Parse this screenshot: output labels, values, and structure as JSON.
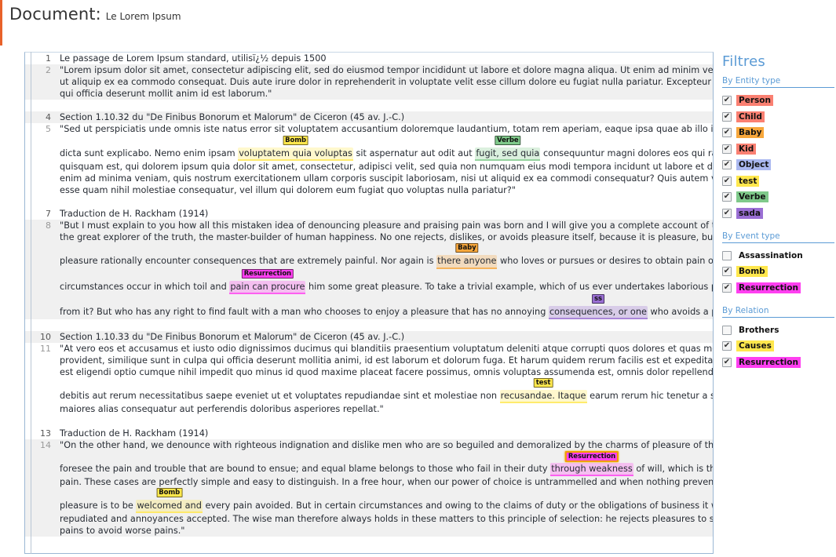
{
  "header": {
    "title": "Document:",
    "subtitle": "Le Lorem Ipsum"
  },
  "colors": {
    "person": "#fa8072",
    "child": "#fa8072",
    "baby": "#f7a73c",
    "kid": "#fa8072",
    "object": "#aab8f0",
    "test": "#ffe74d",
    "verbe": "#7fc98a",
    "sada": "#9a6fd4",
    "bomb": "#ffe74d",
    "resurrection": "#ff3ff0",
    "causes": "#ffe74d",
    "accent_blue": "#5b9bd5",
    "accent_orange": "#e8622a"
  },
  "sidebar": {
    "title": "Filtres",
    "sections": [
      {
        "name": "entity",
        "heading": "By Entity type",
        "items": [
          {
            "label": "Person",
            "checked": true,
            "color": "#fa8072"
          },
          {
            "label": "Child",
            "checked": true,
            "color": "#fa8072"
          },
          {
            "label": "Baby",
            "checked": true,
            "color": "#f7a73c"
          },
          {
            "label": "Kid",
            "checked": true,
            "color": "#fa8072"
          },
          {
            "label": "Object",
            "checked": true,
            "color": "#aab8f0"
          },
          {
            "label": "test",
            "checked": true,
            "color": "#ffe74d"
          },
          {
            "label": "Verbe",
            "checked": true,
            "color": "#7fc98a"
          },
          {
            "label": "sada",
            "checked": true,
            "color": "#9a6fd4"
          }
        ]
      },
      {
        "name": "event",
        "heading": "By Event type",
        "items": [
          {
            "label": "Assassination",
            "checked": false,
            "color": "transparent"
          },
          {
            "label": "Bomb",
            "checked": true,
            "color": "#ffe74d"
          },
          {
            "label": "Resurrection",
            "checked": true,
            "color": "#ff3ff0"
          }
        ]
      },
      {
        "name": "relation",
        "heading": "By Relation",
        "items": [
          {
            "label": "Brothers",
            "checked": false,
            "color": "transparent"
          },
          {
            "label": "Causes",
            "checked": true,
            "color": "#ffe74d"
          },
          {
            "label": "Resurrection",
            "checked": true,
            "color": "#ff3ff0"
          }
        ]
      }
    ]
  },
  "document": {
    "rows": [
      {
        "num": "1",
        "alt": false,
        "dark": true,
        "lines": [
          {
            "parts": [
              {
                "t": "Le passage de Lorem Ipsum standard, utilisï¿½ depuis 1500"
              }
            ]
          }
        ]
      },
      {
        "num": "2",
        "alt": true,
        "dark": false,
        "lines": [
          {
            "parts": [
              {
                "t": "\"Lorem ipsum dolor sit amet, consectetur adipiscing elit, sed do eiusmod tempor incididunt ut labore et dolore magna aliqua. Ut enim ad minim veniam, quis nos"
              }
            ]
          },
          {
            "parts": [
              {
                "t": "ut aliquip ex ea commodo consequat. Duis aute irure dolor in reprehenderit in voluptate velit esse cillum dolore eu fugiat nulla pariatur. Excepteur sint occaecat c"
              }
            ]
          },
          {
            "parts": [
              {
                "t": "qui officia deserunt mollit anim id est laborum.\""
              }
            ]
          }
        ]
      },
      {
        "num": "",
        "alt": false,
        "blank": true,
        "lines": []
      },
      {
        "num": "4",
        "alt": true,
        "dark": true,
        "lines": [
          {
            "parts": [
              {
                "t": "Section 1.10.32 du \"De Finibus Bonorum et Malorum\" de Ciceron (45 av. J.-C.)"
              }
            ]
          }
        ]
      },
      {
        "num": "5",
        "alt": false,
        "dark": false,
        "lines": [
          {
            "parts": [
              {
                "t": "\"Sed ut perspiciatis unde omnis iste natus error sit voluptatem accusantium doloremque laudantium, totam rem aperiam, eaque ipsa quae ab illo inventore verita"
              }
            ]
          },
          {
            "parts": [
              {
                "t": ""
              }
            ]
          },
          {
            "parts": [
              {
                "t": "dicta sunt explicabo. Nemo enim ipsam "
              },
              {
                "t": "voluptatem quia voluptas",
                "ann": {
                  "label": "Bomb",
                  "color": "#ffe74d"
                }
              },
              {
                "t": " sit aspernatur aut odit aut "
              },
              {
                "t": "fugit, sed quia",
                "ann": {
                  "label": "Verbe",
                  "color": "#7fc98a"
                }
              },
              {
                "t": " consequuntur magni dolores eos qui ratione voluptat"
              }
            ]
          },
          {
            "parts": [
              {
                "t": "quisquam est, qui dolorem ipsum quia dolor sit amet, consectetur, adipisci velit, sed quia non numquam eius modi tempora incidunt ut labore et dolore magnam"
              }
            ]
          },
          {
            "parts": [
              {
                "t": "enim ad minima veniam, quis nostrum exercitationem ullam corporis suscipit laboriosam, nisi ut aliquid ex ea commodi consequatur? Quis autem vel eum iure re"
              }
            ]
          },
          {
            "parts": [
              {
                "t": "esse quam nihil molestiae consequatur, vel illum qui dolorem eum fugiat quo voluptas nulla pariatur?\""
              }
            ]
          }
        ]
      },
      {
        "num": "",
        "alt": true,
        "blank": true,
        "lines": []
      },
      {
        "num": "7",
        "alt": false,
        "dark": true,
        "lines": [
          {
            "parts": [
              {
                "t": "Traduction de H. Rackham (1914)"
              }
            ]
          }
        ]
      },
      {
        "num": "8",
        "alt": true,
        "dark": false,
        "lines": [
          {
            "parts": [
              {
                "t": "\"But I must explain to you how all this mistaken idea of denouncing pleasure and praising pain was born and I will give you a complete account of the system, an"
              }
            ]
          },
          {
            "parts": [
              {
                "t": "the great explorer of the truth, the master-builder of human happiness. No one rejects, dislikes, or avoids pleasure itself, because it is pleasure, but because tho"
              }
            ]
          },
          {
            "parts": [
              {
                "t": ""
              }
            ]
          },
          {
            "parts": [
              {
                "t": "pleasure rationally encounter consequences that are extremely painful. Nor again is "
              },
              {
                "t": "there anyone",
                "ann": {
                  "label": "Baby",
                  "color": "#f7a73c"
                }
              },
              {
                "t": " who loves or pursues or desires to obtain pain of itself, because"
              }
            ]
          },
          {
            "parts": [
              {
                "t": ""
              }
            ]
          },
          {
            "parts": [
              {
                "t": "circumstances occur in which toil and "
              },
              {
                "t": "pain can procure",
                "ann": {
                  "label": "Resurrection",
                  "color": "#ff3ff0"
                }
              },
              {
                "t": " him some great pleasure. To take a trivial example, which of us ever undertakes laborious physical exerci"
              }
            ]
          },
          {
            "parts": [
              {
                "t": ""
              }
            ]
          },
          {
            "parts": [
              {
                "t": "from it? But who has any right to find fault with a man who chooses to enjoy a pleasure that has no annoying "
              },
              {
                "t": "consequences, or one",
                "ann": {
                  "label": "ss",
                  "color": "#9a6fd4"
                }
              },
              {
                "t": " who avoids a pain that produ"
              }
            ]
          }
        ]
      },
      {
        "num": "",
        "alt": false,
        "blank": true,
        "lines": []
      },
      {
        "num": "10",
        "alt": true,
        "dark": true,
        "lines": [
          {
            "parts": [
              {
                "t": "Section 1.10.33 du \"De Finibus Bonorum et Malorum\" de Ciceron (45 av. J.-C.)"
              }
            ]
          }
        ]
      },
      {
        "num": "11",
        "alt": false,
        "dark": false,
        "lines": [
          {
            "parts": [
              {
                "t": "\"At vero eos et accusamus et iusto odio dignissimos ducimus qui blanditiis praesentium voluptatum deleniti atque corrupti quos dolores et quas molestias except"
              }
            ]
          },
          {
            "parts": [
              {
                "t": "provident, similique sunt in culpa qui officia deserunt mollitia animi, id est laborum et dolorum fuga. Et harum quidem rerum facilis est et expedita distinctio. Nar"
              }
            ]
          },
          {
            "parts": [
              {
                "t": "est eligendi optio cumque nihil impedit quo minus id quod maxime placeat facere possimus, omnis voluptas assumenda est, omnis dolor repellendus. Temporibus"
              }
            ]
          },
          {
            "parts": [
              {
                "t": ""
              }
            ]
          },
          {
            "parts": [
              {
                "t": "debitis aut rerum necessitatibus saepe eveniet ut et voluptates repudiandae sint et molestiae non "
              },
              {
                "t": "recusandae. Itaque",
                "ann": {
                  "label": "test",
                  "color": "#ffe74d"
                }
              },
              {
                "t": " earum rerum hic tenetur a sapiente delect"
              }
            ]
          },
          {
            "parts": [
              {
                "t": "maiores alias consequatur aut perferendis doloribus asperiores repellat.\""
              }
            ]
          }
        ]
      },
      {
        "num": "",
        "alt": true,
        "blank": true,
        "lines": []
      },
      {
        "num": "13",
        "alt": false,
        "dark": true,
        "lines": [
          {
            "parts": [
              {
                "t": "Traduction de H. Rackham (1914)"
              }
            ]
          }
        ]
      },
      {
        "num": "14",
        "alt": true,
        "dark": false,
        "lines": [
          {
            "parts": [
              {
                "t": "\"On the other hand, we denounce with righteous indignation and dislike men who are so beguiled and demoralized by the charms of pleasure of the moment, so"
              }
            ]
          },
          {
            "parts": [
              {
                "t": ""
              }
            ]
          },
          {
            "parts": [
              {
                "t": "foresee the pain and trouble that are bound to ensue; and equal blame belongs to those who fail in their duty "
              },
              {
                "t": "through weakness",
                "ann": {
                  "label": "Resurrection",
                  "color": "#ff3ff0",
                  "selected": true
                }
              },
              {
                "t": " of will, which is the same as say"
              }
            ]
          },
          {
            "parts": [
              {
                "t": "pain. These cases are perfectly simple and easy to distinguish. In a free hour, when our power of choice is untrammelled and when nothing prevents our being ab"
              }
            ]
          },
          {
            "parts": [
              {
                "t": ""
              }
            ]
          },
          {
            "parts": [
              {
                "t": "pleasure is to be "
              },
              {
                "t": "welcomed and",
                "ann": {
                  "label": "Bomb",
                  "color": "#ffe74d"
                }
              },
              {
                "t": " every pain avoided. But in certain circumstances and owing to the claims of duty or the obligations of business it will frequently o"
              }
            ]
          },
          {
            "parts": [
              {
                "t": "repudiated and annoyances accepted. The wise man therefore always holds in these matters to this principle of selection: he rejects pleasures to secure other gr"
              }
            ]
          },
          {
            "parts": [
              {
                "t": "pains to avoid worse pains.\""
              }
            ]
          }
        ]
      }
    ]
  }
}
